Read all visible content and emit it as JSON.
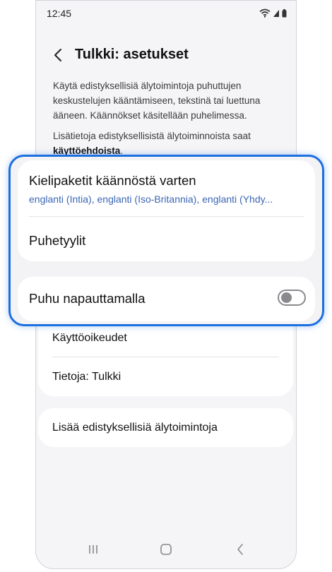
{
  "status_bar": {
    "time": "12:45"
  },
  "header": {
    "title": "Tulkki: asetukset"
  },
  "description": {
    "paragraph1": "Käytä edistyksellisiä älytoimintoja puhuttujen keskustelujen kääntämiseen, tekstinä tai luettuna ääneen. Käännökset käsitellään puhelimessa.",
    "paragraph2_prefix": "Lisätietoja edistyksellisistä älytoiminnoista saat",
    "paragraph2_link": "käyttöehdoista",
    "paragraph2_suffix": "."
  },
  "highlighted": {
    "language_packs": {
      "title": "Kielipaketit käännöstä varten",
      "subtitle": "englanti (Intia), englanti (Iso-Britannia), englanti (Yhdy..."
    },
    "speech_styles": {
      "title": "Puhetyylit"
    },
    "tap_to_speak": {
      "title": "Puhu napauttamalla",
      "enabled": false
    }
  },
  "settings_list": {
    "permissions": "Käyttöoikeudet",
    "about": "Tietoja: Tulkki",
    "more_features": "Lisää edistyksellisiä älytoimintoja"
  },
  "colors": {
    "highlight_border": "#1c6fe0",
    "subtitle_blue": "#3b66b5"
  }
}
